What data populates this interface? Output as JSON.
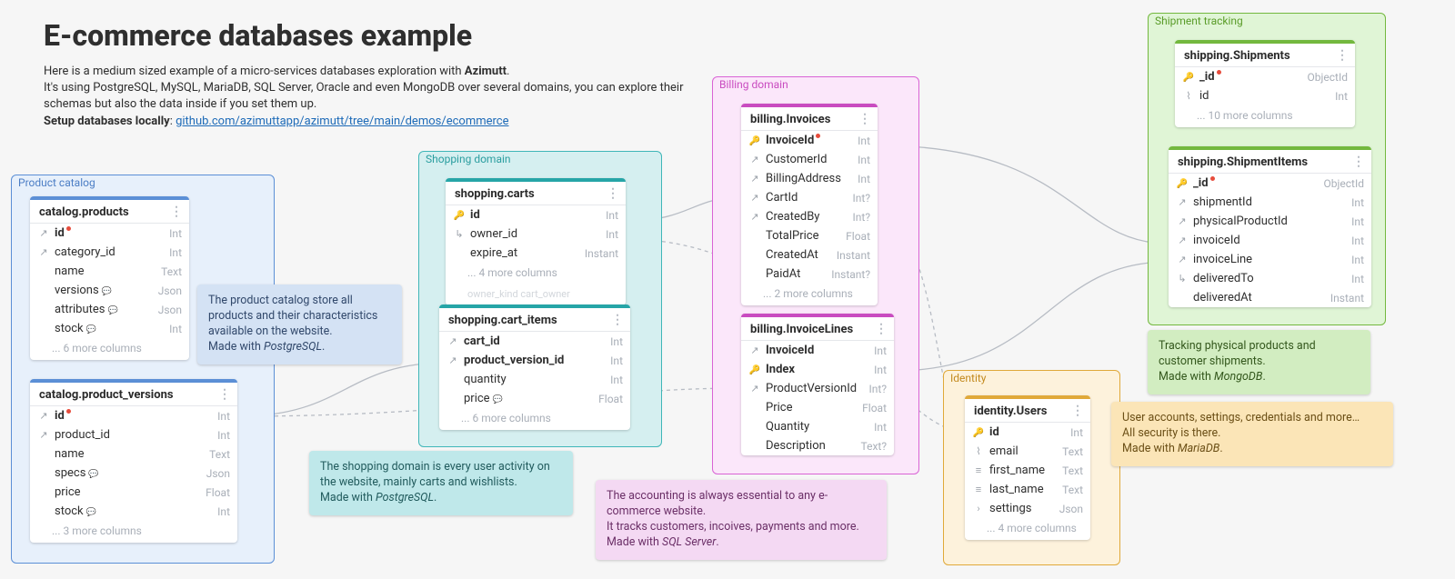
{
  "header": {
    "title": "E-commerce databases example",
    "intro_line1_a": "Here is a medium sized example of a micro-services databases exploration with ",
    "intro_line1_b": "Azimutt",
    "intro_line1_c": ".",
    "intro_line2": "It's using PostgreSQL, MySQL, MariaDB, SQL Server, Oracle and even MongoDB over several domains, you can explore their schemas but also the data inside if you set them up.",
    "setup_label": "Setup databases locally",
    "setup_link": "github.com/azimuttapp/azimutt/tree/main/demos/ecommerce"
  },
  "domains": {
    "catalog": {
      "title": "Product catalog"
    },
    "shopping": {
      "title": "Shopping domain"
    },
    "billing": {
      "title": "Billing domain"
    },
    "identity": {
      "title": "Identity"
    },
    "shipping": {
      "title": "Shipment tracking"
    }
  },
  "tables": {
    "products": {
      "name": "catalog.products",
      "rows": [
        {
          "ic": "fk",
          "nm": "id",
          "ty": "Int",
          "bold": true,
          "dot": true
        },
        {
          "ic": "fk",
          "nm": "category_id",
          "ty": "Int"
        },
        {
          "ic": "",
          "nm": "name",
          "ty": "Text"
        },
        {
          "ic": "",
          "nm": "versions",
          "ty": "Json",
          "bubble": true
        },
        {
          "ic": "",
          "nm": "attributes",
          "ty": "Json",
          "bubble": true
        },
        {
          "ic": "",
          "nm": "stock",
          "ty": "Int",
          "bubble": true
        }
      ],
      "more": "... 6 more columns"
    },
    "product_versions": {
      "name": "catalog.product_versions",
      "rows": [
        {
          "ic": "fk",
          "nm": "id",
          "ty": "Int",
          "bold": true,
          "dot": true
        },
        {
          "ic": "fk",
          "nm": "product_id",
          "ty": "Int"
        },
        {
          "ic": "",
          "nm": "name",
          "ty": "Text"
        },
        {
          "ic": "",
          "nm": "specs",
          "ty": "Json",
          "bubble": true
        },
        {
          "ic": "",
          "nm": "price",
          "ty": "Float"
        },
        {
          "ic": "",
          "nm": "stock",
          "ty": "Int",
          "bubble": true
        }
      ],
      "more": "... 3 more columns"
    },
    "carts": {
      "name": "shopping.carts",
      "rows": [
        {
          "ic": "key",
          "nm": "id",
          "ty": "Int",
          "bold": true
        },
        {
          "ic": "in",
          "nm": "owner_id",
          "ty": "Int"
        },
        {
          "ic": "",
          "nm": "expire_at",
          "ty": "Instant"
        }
      ],
      "more": "... 4 more columns",
      "ghost": "owner_kind         cart_owner"
    },
    "cart_items": {
      "name": "shopping.cart_items",
      "rows": [
        {
          "ic": "fk",
          "nm": "cart_id",
          "ty": "Int",
          "bold": true
        },
        {
          "ic": "fk",
          "nm": "product_version_id",
          "ty": "Int",
          "bold": true
        },
        {
          "ic": "",
          "nm": "quantity",
          "ty": "Int"
        },
        {
          "ic": "",
          "nm": "price",
          "ty": "Float",
          "bubble": true
        }
      ],
      "more": "... 6 more columns"
    },
    "invoices": {
      "name": "billing.Invoices",
      "rows": [
        {
          "ic": "key",
          "nm": "InvoiceId",
          "ty": "Int",
          "bold": true,
          "dot": true
        },
        {
          "ic": "fk",
          "nm": "CustomerId",
          "ty": "Int"
        },
        {
          "ic": "fk",
          "nm": "BillingAddress",
          "ty": "Int"
        },
        {
          "ic": "fk",
          "nm": "CartId",
          "ty": "Int?"
        },
        {
          "ic": "fk",
          "nm": "CreatedBy",
          "ty": "Int?"
        },
        {
          "ic": "",
          "nm": "TotalPrice",
          "ty": "Float"
        },
        {
          "ic": "",
          "nm": "CreatedAt",
          "ty": "Instant"
        },
        {
          "ic": "",
          "nm": "PaidAt",
          "ty": "Instant?"
        }
      ],
      "more": "... 2 more columns"
    },
    "invoice_lines": {
      "name": "billing.InvoiceLines",
      "rows": [
        {
          "ic": "fk",
          "nm": "InvoiceId",
          "ty": "Int",
          "bold": true
        },
        {
          "ic": "key",
          "nm": "Index",
          "ty": "Int",
          "bold": true
        },
        {
          "ic": "fk",
          "nm": "ProductVersionId",
          "ty": "Int?"
        },
        {
          "ic": "",
          "nm": "Price",
          "ty": "Float"
        },
        {
          "ic": "",
          "nm": "Quantity",
          "ty": "Int"
        },
        {
          "ic": "",
          "nm": "Description",
          "ty": "Text?"
        }
      ]
    },
    "users": {
      "name": "identity.Users",
      "rows": [
        {
          "ic": "key",
          "nm": "id",
          "ty": "Int",
          "bold": true
        },
        {
          "ic": "wifi",
          "nm": "email",
          "ty": "Text"
        },
        {
          "ic": "list",
          "nm": "first_name",
          "ty": "Text"
        },
        {
          "ic": "list",
          "nm": "last_name",
          "ty": "Text"
        },
        {
          "ic": "ang",
          "nm": "settings",
          "ty": "Json"
        }
      ],
      "more": "... 4 more columns"
    },
    "shipments": {
      "name": "shipping.Shipments",
      "rows": [
        {
          "ic": "key",
          "nm": "_id",
          "ty": "ObjectId",
          "bold": true,
          "dot": true
        },
        {
          "ic": "wifi",
          "nm": "id",
          "ty": "Int"
        }
      ],
      "more": "... 10 more columns"
    },
    "shipment_items": {
      "name": "shipping.ShipmentItems",
      "rows": [
        {
          "ic": "key",
          "nm": "_id",
          "ty": "ObjectId",
          "bold": true,
          "dot": true
        },
        {
          "ic": "fk",
          "nm": "shipmentId",
          "ty": "Int"
        },
        {
          "ic": "fk",
          "nm": "physicalProductId",
          "ty": "Int"
        },
        {
          "ic": "fk",
          "nm": "invoiceId",
          "ty": "Int"
        },
        {
          "ic": "fk",
          "nm": "invoiceLine",
          "ty": "Int"
        },
        {
          "ic": "in",
          "nm": "deliveredTo",
          "ty": "Int"
        },
        {
          "ic": "",
          "nm": "deliveredAt",
          "ty": "Instant"
        }
      ]
    }
  },
  "notes": {
    "catalog": "The product catalog store all products and their characteristics available on the website.\nMade with PostgreSQL.",
    "shopping": "The shopping domain is every user activity on the website, mainly carts and wishlists.\nMade with PostgreSQL.",
    "billing": "The accounting is always essential to any e-commerce website.\nIt tracks customers, incoives, payments and more.\nMade with SQL Server.",
    "identity": "User accounts, settings, credentials and more…\nAll security is there.\nMade with MariaDB.",
    "shipping": "Tracking physical products and customer shipments.\nMade with MongoDB."
  }
}
